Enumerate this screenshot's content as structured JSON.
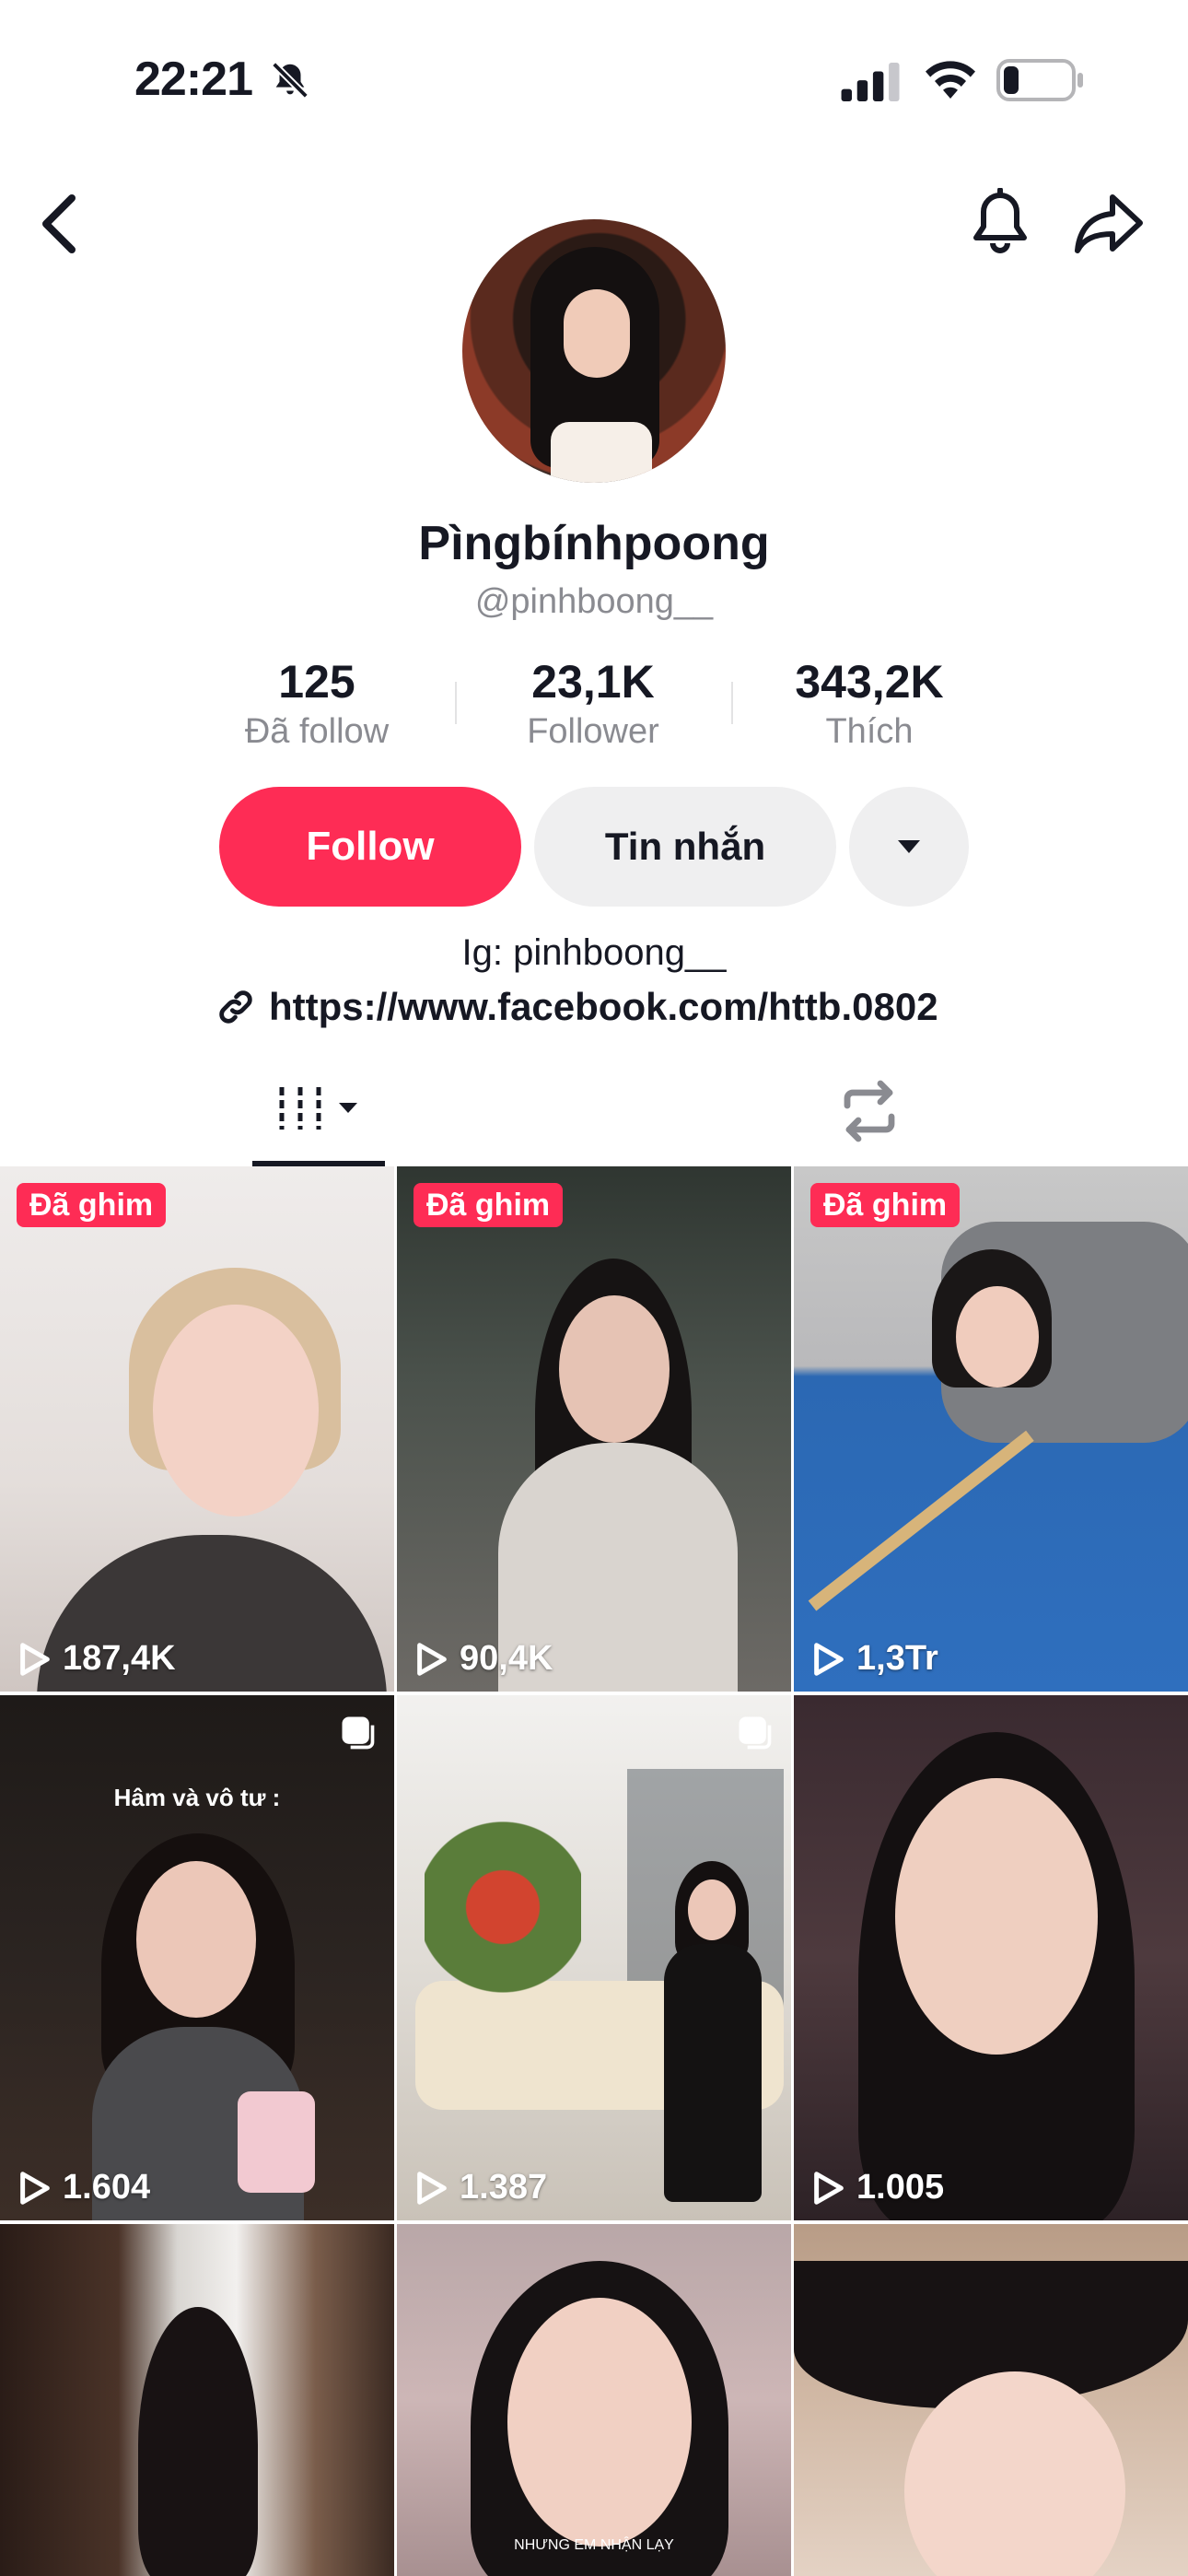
{
  "status_bar": {
    "time": "22:21"
  },
  "profile": {
    "display_name": "Pìngbínhpoong",
    "handle": "@pinhboong__",
    "stats": [
      {
        "value": "125",
        "label": "Đã follow"
      },
      {
        "value": "23,1K",
        "label": "Follower"
      },
      {
        "value": "343,2K",
        "label": "Thích"
      }
    ],
    "follow_label": "Follow",
    "message_label": "Tin nhắn",
    "bio": "Ig: pinhboong__",
    "link": "https://www.facebook.com/httb.0802"
  },
  "videos": [
    {
      "pinned_label": "Đã ghim",
      "views": "187,4K"
    },
    {
      "pinned_label": "Đã ghim",
      "views": "90,4K"
    },
    {
      "pinned_label": "Đã ghim",
      "views": "1,3Tr"
    },
    {
      "caption": "Hâm và vô tư :",
      "views": "1.604"
    },
    {
      "views": "1.387"
    },
    {
      "views": "1.005"
    },
    {},
    {
      "caption": "NHƯNG EM NHẬN LẠY"
    },
    {}
  ],
  "colors": {
    "accent": "#fe2c55",
    "secondary_button": "#efeff0",
    "muted_text": "#8a8b91"
  }
}
